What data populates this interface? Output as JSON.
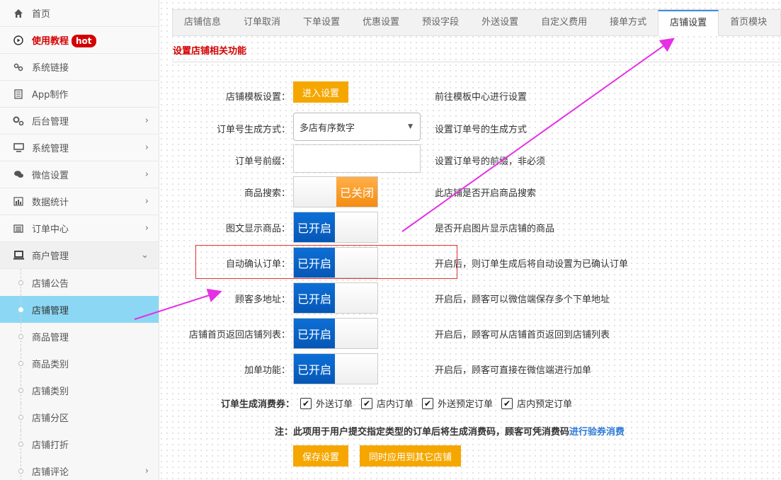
{
  "sidebar": {
    "items": [
      {
        "label": "首页",
        "icon": "home-icon"
      },
      {
        "label": "使用教程",
        "badge": "hot",
        "icon": "play-circle-icon"
      },
      {
        "label": "系统链接",
        "icon": "link-icon"
      },
      {
        "label": "App制作",
        "icon": "file-icon"
      },
      {
        "label": "后台管理",
        "icon": "cogs-icon"
      },
      {
        "label": "系统管理",
        "icon": "monitor-icon"
      },
      {
        "label": "微信设置",
        "icon": "chat-icon"
      },
      {
        "label": "数据统计",
        "icon": "bar-chart-icon"
      },
      {
        "label": "订单中心",
        "icon": "list-icon"
      },
      {
        "label": "商户管理",
        "icon": "laptop-icon"
      }
    ],
    "sub_items": [
      {
        "label": "店铺公告"
      },
      {
        "label": "店铺管理"
      },
      {
        "label": "商品管理"
      },
      {
        "label": "商品类别"
      },
      {
        "label": "店铺类别"
      },
      {
        "label": "店铺分区"
      },
      {
        "label": "店铺打折"
      },
      {
        "label": "店铺评论"
      }
    ]
  },
  "tabs": [
    {
      "label": "店铺信息"
    },
    {
      "label": "订单取消"
    },
    {
      "label": "下单设置"
    },
    {
      "label": "优惠设置"
    },
    {
      "label": "预设字段"
    },
    {
      "label": "外送设置"
    },
    {
      "label": "自定义费用"
    },
    {
      "label": "接单方式"
    },
    {
      "label": "店铺设置"
    },
    {
      "label": "首页模块"
    }
  ],
  "section_title": "设置店铺相关功能",
  "form": {
    "template": {
      "label": "店铺模板设置：",
      "button": "进入设置",
      "desc": "前往模板中心进行设置"
    },
    "order_no_mode": {
      "label": "订单号生成方式：",
      "value": "多店有序数字",
      "desc": "设置订单号的生成方式"
    },
    "order_prefix": {
      "label": "订单号前缀：",
      "value": "",
      "desc": "设置订单号的前缀，非必须"
    },
    "product_search": {
      "label": "商品搜索：",
      "state": "已关闭",
      "desc": "此店铺是否开启商品搜索"
    },
    "image_display": {
      "label": "图文显示商品：",
      "state": "已开启",
      "desc": "是否开启图片显示店铺的商品"
    },
    "auto_confirm": {
      "label": "自动确认订单：",
      "state": "已开启",
      "desc": "开启后，则订单生成后将自动设置为已确认订单"
    },
    "multi_address": {
      "label": "顾客多地址：",
      "state": "已开启",
      "desc": "开启后，顾客可以微信端保存多个下单地址"
    },
    "back_to_list": {
      "label": "店铺首页返回店铺列表：",
      "state": "已开启",
      "desc": "开启后，顾客可从店铺首页返回到店铺列表"
    },
    "add_order": {
      "label": "加单功能：",
      "state": "已开启",
      "desc": "开启后，顾客可直接在微信端进行加单"
    }
  },
  "voucher": {
    "label": "订单生成消费券：",
    "options": [
      {
        "label": "外送订单",
        "checked": true
      },
      {
        "label": "店内订单",
        "checked": true
      },
      {
        "label": "外送预定订单",
        "checked": true
      },
      {
        "label": "店内预定订单",
        "checked": true
      }
    ]
  },
  "note": {
    "text": "注：此项用于用户提交指定类型的订单后将生成消费码，顾客可凭消费码",
    "link": "进行验券消费"
  },
  "actions": {
    "save": "保存设置",
    "apply_all": "同时应用到其它店铺"
  },
  "colors": {
    "accent_orange": "#f5a700",
    "toggle_blue": "#0657b6",
    "highlight_red": "#d40000",
    "arrow_magenta": "#e530e5",
    "active_sub": "#8cd8f4"
  }
}
